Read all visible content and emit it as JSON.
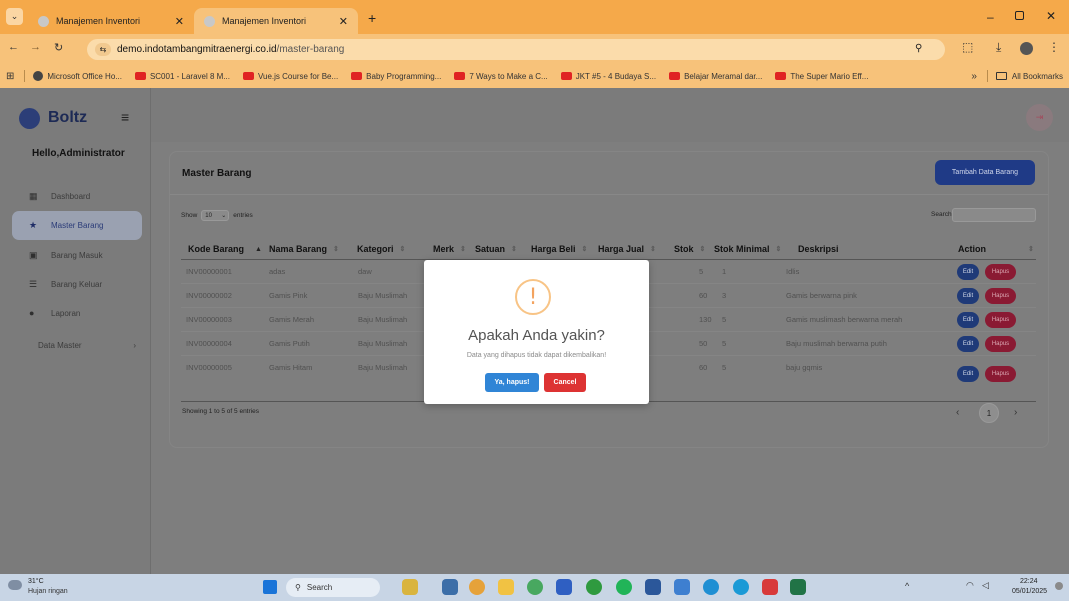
{
  "browser": {
    "tabs": [
      {
        "title": "Manajemen Inventori"
      },
      {
        "title": "Manajemen Inventori"
      }
    ],
    "new_tab": "+",
    "url_host": "demo.indotambangmitraenergi.co.id",
    "url_path": "/master-barang",
    "bookmarks": [
      {
        "label": "Microsoft Office Ho...",
        "icon": "office-icon"
      },
      {
        "label": "SC001 - Laravel 8 M...",
        "icon": "youtube-icon"
      },
      {
        "label": "Vue.js Course for Be...",
        "icon": "youtube-icon"
      },
      {
        "label": "Baby Programming...",
        "icon": "youtube-icon"
      },
      {
        "label": "7 Ways to Make a C...",
        "icon": "youtube-icon"
      },
      {
        "label": "JKT #5 - 4 Budaya S...",
        "icon": "youtube-icon"
      },
      {
        "label": "Belajar Meramal dar...",
        "icon": "youtube-icon"
      },
      {
        "label": "The Super Mario Eff...",
        "icon": "youtube-icon"
      }
    ],
    "more": "»",
    "all_bookmarks": "All Bookmarks"
  },
  "app": {
    "brand": "Boltz",
    "greeting": "Hello,Administrator",
    "nav": [
      {
        "label": "Dashboard",
        "icon": "grid-icon"
      },
      {
        "label": "Master Barang",
        "icon": "star-icon",
        "active": true
      },
      {
        "label": "Barang Masuk",
        "icon": "inbox-icon"
      },
      {
        "label": "Barang Keluar",
        "icon": "list-icon"
      },
      {
        "label": "Laporan",
        "icon": "report-icon"
      },
      {
        "label": "Data Master",
        "icon": "",
        "chevron": "›"
      }
    ]
  },
  "page": {
    "title": "Master Barang",
    "add_button": "Tambah Data Barang",
    "show_label": "Show",
    "show_value": "10",
    "entries_label": "entries",
    "search_label": "Search:",
    "search_value": "",
    "columns": [
      "Kode Barang",
      "Nama Barang",
      "Kategori",
      "Merk",
      "Satuan",
      "Harga Beli",
      "Harga Jual",
      "Stok",
      "Stok Minimal",
      "Deskripsi",
      "Action"
    ],
    "rows": [
      {
        "kode": "INV00000001",
        "nama": "adas",
        "kategori": "daw",
        "stok": "5",
        "stok_min": "1",
        "deskripsi": "Idlis"
      },
      {
        "kode": "INV00000002",
        "nama": "Gamis Pink",
        "kategori": "Baju Muslimah",
        "stok": "60",
        "stok_min": "3",
        "deskripsi": "Gamis berwarna pink"
      },
      {
        "kode": "INV00000003",
        "nama": "Gamis Merah",
        "kategori": "Baju Muslimah",
        "stok": "130",
        "stok_min": "5",
        "deskripsi": "Gamis muslimash berwarna merah"
      },
      {
        "kode": "INV00000004",
        "nama": "Gamis Putih",
        "kategori": "Baju Muslimah",
        "stok": "50",
        "stok_min": "5",
        "deskripsi": "Baju muslimah berwarna putih"
      },
      {
        "kode": "INV00000005",
        "nama": "Gamis Hitam",
        "kategori": "Baju Muslimah",
        "stok": "60",
        "stok_min": "5",
        "deskripsi": "baju gqmis"
      }
    ],
    "edit_label": "Edit",
    "hapus_label": "Hapus",
    "info": "Showing 1 to 5 of 5 entries",
    "prev": "‹",
    "current_page": "1",
    "next": "›"
  },
  "modal": {
    "icon": "!",
    "title": "Apakah Anda yakin?",
    "message": "Data yang dihapus tidak dapat dikembalikan!",
    "confirm": "Ya, hapus!",
    "cancel": "Cancel"
  },
  "taskbar": {
    "temp": "31°C",
    "weather": "Hujan ringan",
    "search": "Search",
    "time": "22:24",
    "date": "05/01/2025"
  },
  "colors": {
    "accent": "#2a4ea8",
    "danger": "#d3294a",
    "confirm": "#3085d6",
    "cancel": "#dd3333",
    "warning": "#f8bb86"
  }
}
